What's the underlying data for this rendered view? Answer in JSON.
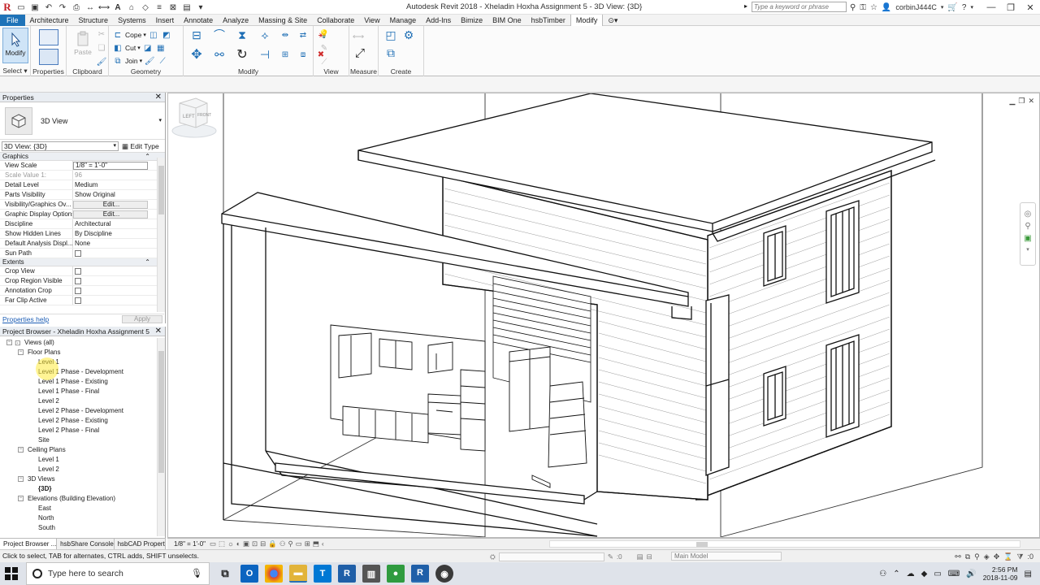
{
  "titlebar": {
    "title": "Autodesk Revit 2018 -    Xheladin Hoxha Assignment 5 - 3D View: {3D}",
    "search_placeholder": "Type a keyword or phrase",
    "user": "corbinJ444C"
  },
  "ribbon_tabs": [
    "File",
    "Architecture",
    "Structure",
    "Systems",
    "Insert",
    "Annotate",
    "Analyze",
    "Massing & Site",
    "Collaborate",
    "View",
    "Manage",
    "Add-Ins",
    "Bimize",
    "BIM One",
    "hsbTimber",
    "Modify"
  ],
  "active_tab": "Modify",
  "ribbon": {
    "modify_label": "Modify",
    "paste_label": "Paste",
    "cope_label": "Cope",
    "cut_label": "Cut",
    "join_label": "Join",
    "groups": {
      "select": "Select",
      "properties": "Properties",
      "clipboard": "Clipboard",
      "geometry": "Geometry",
      "modify": "Modify",
      "view": "View",
      "measure": "Measure",
      "create": "Create"
    }
  },
  "properties": {
    "header": "Properties",
    "type_name": "3D View",
    "view_selector": "3D View: {3D}",
    "edit_type": "Edit Type",
    "groups": {
      "graphics": "Graphics",
      "extents": "Extents"
    },
    "graphics_rows": [
      {
        "k": "View Scale",
        "v": "1/8\" = 1'-0\"",
        "style": "input"
      },
      {
        "k": "Scale Value    1:",
        "v": "96",
        "style": "dim"
      },
      {
        "k": "Detail Level",
        "v": "Medium",
        "style": ""
      },
      {
        "k": "Parts Visibility",
        "v": "Show Original",
        "style": ""
      },
      {
        "k": "Visibility/Graphics Ov...",
        "v": "Edit...",
        "style": "btn"
      },
      {
        "k": "Graphic Display Options",
        "v": "Edit...",
        "style": "btn"
      },
      {
        "k": "Discipline",
        "v": "Architectural",
        "style": ""
      },
      {
        "k": "Show Hidden Lines",
        "v": "By Discipline",
        "style": ""
      },
      {
        "k": "Default Analysis Displ...",
        "v": "None",
        "style": ""
      },
      {
        "k": "Sun Path",
        "v": "",
        "style": "check"
      }
    ],
    "extents_rows": [
      {
        "k": "Crop View",
        "v": "",
        "style": "check"
      },
      {
        "k": "Crop Region Visible",
        "v": "",
        "style": "check"
      },
      {
        "k": "Annotation Crop",
        "v": "",
        "style": "check"
      },
      {
        "k": "Far Clip Active",
        "v": "",
        "style": "check"
      }
    ],
    "help_link": "Properties help",
    "apply": "Apply"
  },
  "browser": {
    "header": "Project Browser - Xheladin Hoxha Assignment 5",
    "tree": [
      {
        "label": "Views (all)",
        "level": 0,
        "toggle": "−",
        "icon": "views"
      },
      {
        "label": "Floor Plans",
        "level": 1,
        "toggle": "−"
      },
      {
        "label": "Level 1",
        "level": 2
      },
      {
        "label": "Level 1 Phase - Development",
        "level": 2
      },
      {
        "label": "Level 1 Phase - Existing",
        "level": 2
      },
      {
        "label": "Level 1 Phase - Final",
        "level": 2
      },
      {
        "label": "Level 2",
        "level": 2
      },
      {
        "label": "Level 2 Phase - Development",
        "level": 2
      },
      {
        "label": "Level 2 Phase - Existing",
        "level": 2
      },
      {
        "label": "Level 2 Phase - Final",
        "level": 2
      },
      {
        "label": "Site",
        "level": 2
      },
      {
        "label": "Ceiling Plans",
        "level": 1,
        "toggle": "−"
      },
      {
        "label": "Level 1",
        "level": 2
      },
      {
        "label": "Level 2",
        "level": 2
      },
      {
        "label": "3D Views",
        "level": 1,
        "toggle": "−"
      },
      {
        "label": "{3D}",
        "level": 2,
        "bold": true
      },
      {
        "label": "Elevations (Building Elevation)",
        "level": 1,
        "toggle": "−"
      },
      {
        "label": "East",
        "level": 2
      },
      {
        "label": "North",
        "level": 2
      },
      {
        "label": "South",
        "level": 2
      }
    ]
  },
  "left_tabs": [
    "Project Browser ...",
    "hsbShare Console",
    "hsbCAD Propert"
  ],
  "view_bar": {
    "scale": "1/8\" = 1'-0\""
  },
  "viewcube": {
    "left": "LEFT",
    "front": "FRONT"
  },
  "status": {
    "text": "Click to select, TAB for alternates, CTRL adds, SHIFT unselects.",
    "coord": ":0",
    "model": "Main Model"
  },
  "taskbar": {
    "search_placeholder": "Type here to search",
    "time": "2:56 PM",
    "date": "2018-11-09"
  },
  "colors": {
    "accent": "#1f73b8",
    "revit_red": "#c42127"
  }
}
